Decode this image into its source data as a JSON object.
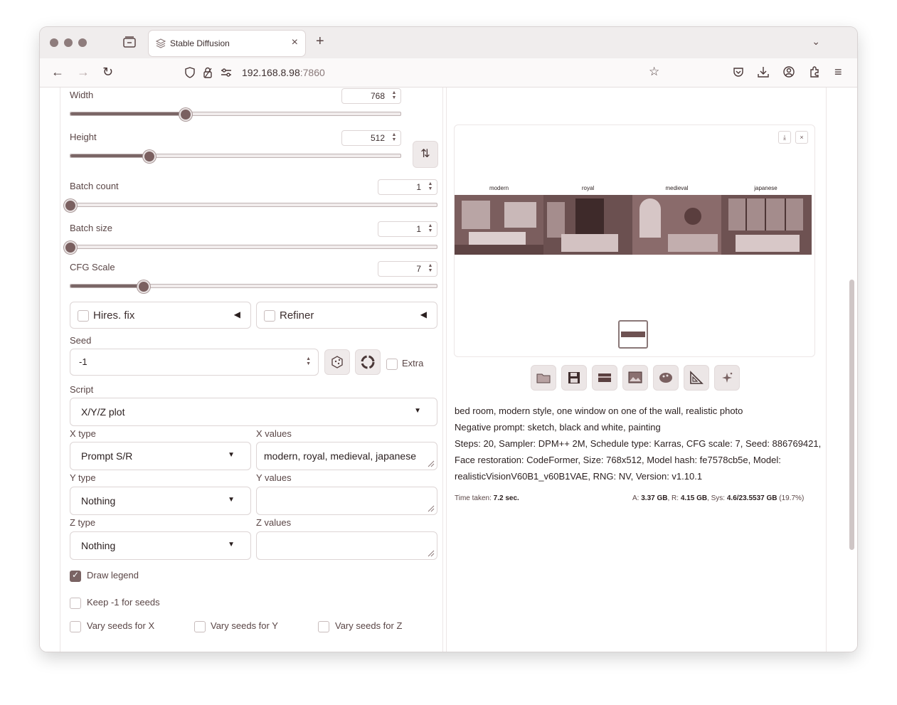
{
  "browser": {
    "tab_title": "Stable Diffusion",
    "url_host": "192.168.8.98",
    "url_port": ":7860"
  },
  "sliders": {
    "width": {
      "label": "Width",
      "value": "768",
      "fraction": 0.35
    },
    "height": {
      "label": "Height",
      "value": "512",
      "fraction": 0.24
    },
    "batch_count": {
      "label": "Batch count",
      "value": "1",
      "fraction": 0.0
    },
    "batch_size": {
      "label": "Batch size",
      "value": "1",
      "fraction": 0.0
    },
    "cfg_scale": {
      "label": "CFG Scale",
      "value": "7",
      "fraction": 0.2
    }
  },
  "hires": {
    "label": "Hires. fix"
  },
  "refiner": {
    "label": "Refiner"
  },
  "seed": {
    "label": "Seed",
    "value": "-1",
    "extra_label": "Extra"
  },
  "script": {
    "label": "Script",
    "value": "X/Y/Z plot"
  },
  "xyz": {
    "x_type_label": "X type",
    "x_type": "Prompt S/R",
    "x_values_label": "X values",
    "x_values": "modern, royal, medieval, japanese",
    "y_type_label": "Y type",
    "y_type": "Nothing",
    "y_values_label": "Y values",
    "y_values": "",
    "z_type_label": "Z type",
    "z_type": "Nothing",
    "z_values_label": "Z values",
    "z_values": ""
  },
  "options": {
    "draw_legend": "Draw legend",
    "keep_seeds": "Keep -1 for seeds",
    "vary_x": "Vary seeds for X",
    "vary_y": "Vary seeds for Y",
    "vary_z": "Vary seeds for Z"
  },
  "gallery": {
    "captions": [
      "modern",
      "royal",
      "medieval",
      "japanese"
    ]
  },
  "info": {
    "prompt": "bed room, modern style, one window on one of the wall, realistic photo",
    "negative": "Negative prompt: sketch, black and white, painting",
    "params1": "Steps: 20, Sampler: DPM++ 2M, Schedule type: Karras, CFG scale: 7, Seed: 886769421,",
    "params2": "Face restoration: CodeFormer, Size: 768x512, Model hash: fe7578cb5e, Model:",
    "params3": "realisticVisionV60B1_v60B1VAE, RNG: NV, Version: v1.10.1"
  },
  "stats": {
    "time_label": "Time taken:",
    "time_value": "7.2 sec.",
    "a_label": "A:",
    "a_value": "3.37 GB",
    "r_label": "R:",
    "r_value": "4.15 GB",
    "sys_label": "Sys:",
    "sys_value": "4.6/23.5537 GB",
    "sys_pct": "(19.7%)"
  },
  "colors": {
    "accent": "#7a6363",
    "panel_border": "#ece6e6"
  }
}
